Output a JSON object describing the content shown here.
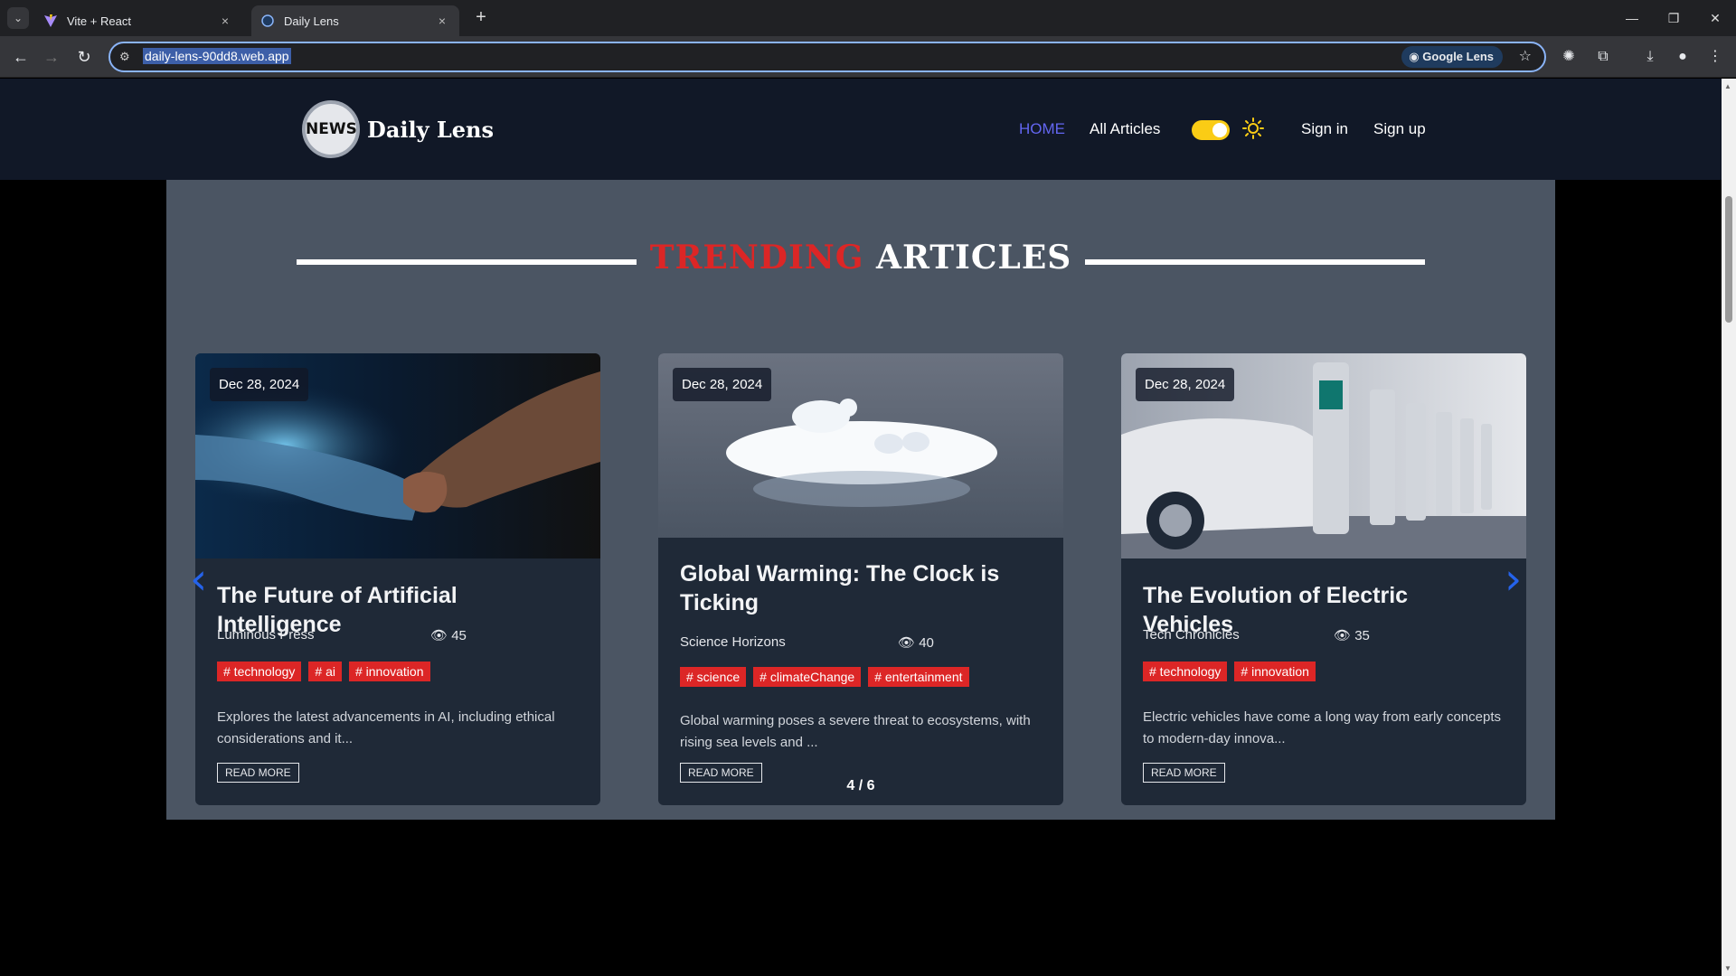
{
  "browser": {
    "tabs": [
      {
        "title": "Vite + React",
        "close": "×"
      },
      {
        "title": "Daily Lens",
        "close": "×"
      }
    ],
    "new_tab": "+",
    "window_controls": {
      "minimize": "—",
      "restore": "❐",
      "close": "✕"
    },
    "url": "daily-lens-90dd8.web.app",
    "lens_label": "Google Lens",
    "icons": [
      "back-icon",
      "forward-icon",
      "reload-icon",
      "site-info-icon",
      "star-icon",
      "extension-icon",
      "puzzle-icon",
      "download-icon",
      "profile-icon",
      "menu-icon"
    ]
  },
  "site": {
    "logo_text": "NEWS",
    "name": "Daily Lens",
    "nav": {
      "home": "HOME",
      "all_articles": "All Articles",
      "sign_in": "Sign in",
      "sign_up": "Sign up"
    },
    "theme_toggle": {
      "state": "on",
      "icon": "sun-icon"
    },
    "accent_colors": {
      "nav_active": "#6366f1",
      "tag": "#dc2626",
      "toggle": "#facc15",
      "arrow": "#2563eb"
    }
  },
  "section": {
    "title_highlight": "TRENDING",
    "title_rest": "ARTICLES",
    "pager": "4 / 6",
    "arrows": {
      "prev": "‹",
      "next": "›"
    }
  },
  "articles": [
    {
      "date": "Dec 28, 2024",
      "title": "The Future of Artificial Intelligence",
      "publisher": "Luminous Press",
      "views": "45",
      "tags": [
        "# technology",
        "# ai",
        "# innovation"
      ],
      "description": "Explores the latest advancements in AI, including ethical considerations and it...",
      "read_more": "READ MORE",
      "image": "robot-human-handshake"
    },
    {
      "date": "Dec 28, 2024",
      "title": "Global Warming: The Clock is Ticking",
      "publisher": "Science Horizons",
      "views": "40",
      "tags": [
        "# science",
        "# climateChange",
        "# entertainment"
      ],
      "description": "Global warming poses a severe threat to ecosystems, with rising sea levels and ...",
      "read_more": "READ MORE",
      "image": "polar-bears-on-ice"
    },
    {
      "date": "Dec 28, 2024",
      "title": "The Evolution of Electric Vehicles",
      "publisher": "Tech Chronicles",
      "views": "35",
      "tags": [
        "# technology",
        "# innovation"
      ],
      "description": "Electric vehicles have come a long way from early concepts to modern-day innova...",
      "read_more": "READ MORE",
      "image": "electric-car-charging"
    }
  ]
}
